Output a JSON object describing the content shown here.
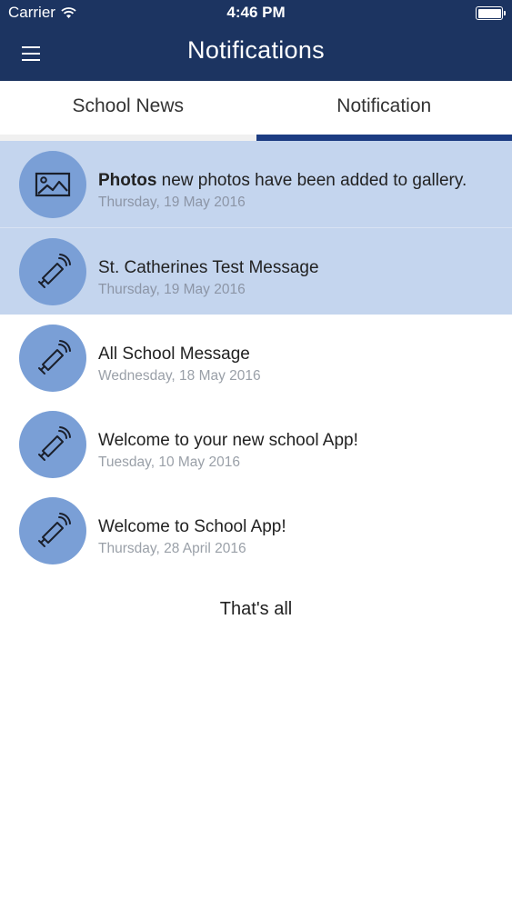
{
  "status_bar": {
    "carrier": "Carrier",
    "time": "4:46 PM"
  },
  "header": {
    "title": "Notifications",
    "menu_icon": "hamburger-menu-icon",
    "bg_color": "#1c3461"
  },
  "tabs": [
    {
      "label": "School News",
      "active": false
    },
    {
      "label": "Notification",
      "active": true
    }
  ],
  "notifications": [
    {
      "icon": "photo-icon",
      "bold": "Photos",
      "text": " new photos have been added to gallery.",
      "date": "Thursday, 19 May 2016",
      "unread": true
    },
    {
      "icon": "megaphone-icon",
      "bold": "",
      "text": "St. Catherines Test Message",
      "date": "Thursday, 19 May 2016",
      "unread": true
    },
    {
      "icon": "megaphone-icon",
      "bold": "",
      "text": "All School Message",
      "date": "Wednesday, 18 May 2016",
      "unread": false
    },
    {
      "icon": "megaphone-icon",
      "bold": "",
      "text": "Welcome to your new school App!",
      "date": "Tuesday, 10 May 2016",
      "unread": false
    },
    {
      "icon": "megaphone-icon",
      "bold": "",
      "text": "Welcome to School App!",
      "date": "Thursday, 28 April 2016",
      "unread": false
    }
  ],
  "footer_note": "That's all",
  "colors": {
    "unread_bg": "#c4d5ee",
    "avatar_bg": "#7a9fd6",
    "active_tab_indicator": "#1c3c82"
  }
}
